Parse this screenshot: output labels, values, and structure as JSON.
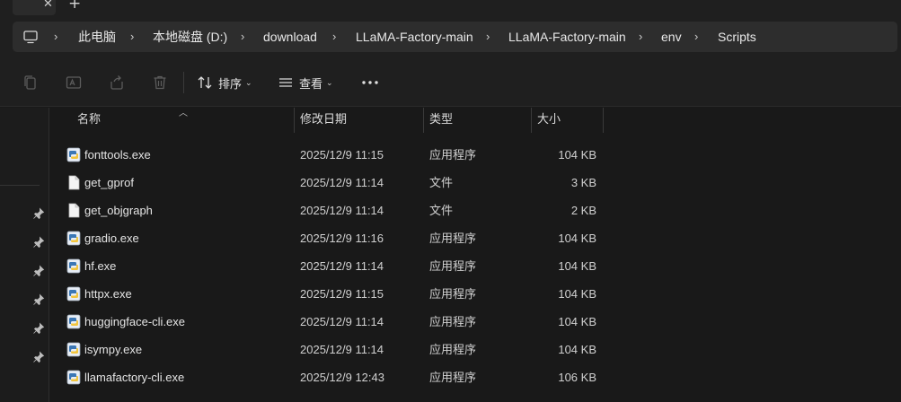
{
  "tabs": {
    "close_glyph": "✕",
    "new_tab_glyph": "+"
  },
  "address": {
    "breadcrumbs": [
      "此电脑",
      "本地磁盘 (D:)",
      "download",
      "LLaMA-Factory-main",
      "LLaMA-Factory-main",
      "env",
      "Scripts"
    ],
    "separator": "›"
  },
  "toolbar": {
    "sort_label": "排序",
    "view_label": "查看",
    "chevron": "⌄",
    "icons": [
      "copy-icon",
      "rename-icon",
      "share-icon",
      "delete-icon",
      "sort-icon",
      "view-icon",
      "more-icon"
    ]
  },
  "columns": {
    "name": "名称",
    "date": "修改日期",
    "type": "类型",
    "size": "大小"
  },
  "files": [
    {
      "name": "fonttools.exe",
      "date": "2025/12/9 11:15",
      "type": "应用程序",
      "size": "104 KB",
      "icon": "python-exe-icon"
    },
    {
      "name": "get_gprof",
      "date": "2025/12/9 11:14",
      "type": "文件",
      "size": "3 KB",
      "icon": "file-icon"
    },
    {
      "name": "get_objgraph",
      "date": "2025/12/9 11:14",
      "type": "文件",
      "size": "2 KB",
      "icon": "file-icon"
    },
    {
      "name": "gradio.exe",
      "date": "2025/12/9 11:16",
      "type": "应用程序",
      "size": "104 KB",
      "icon": "python-exe-icon"
    },
    {
      "name": "hf.exe",
      "date": "2025/12/9 11:14",
      "type": "应用程序",
      "size": "104 KB",
      "icon": "python-exe-icon"
    },
    {
      "name": "httpx.exe",
      "date": "2025/12/9 11:15",
      "type": "应用程序",
      "size": "104 KB",
      "icon": "python-exe-icon"
    },
    {
      "name": "huggingface-cli.exe",
      "date": "2025/12/9 11:14",
      "type": "应用程序",
      "size": "104 KB",
      "icon": "python-exe-icon"
    },
    {
      "name": "isympy.exe",
      "date": "2025/12/9 11:14",
      "type": "应用程序",
      "size": "104 KB",
      "icon": "python-exe-icon"
    },
    {
      "name": "llamafactory-cli.exe",
      "date": "2025/12/9 12:43",
      "type": "应用程序",
      "size": "106 KB",
      "icon": "python-exe-icon"
    }
  ],
  "colors": {
    "background": "#191919",
    "toolbar": "#1f1f1f",
    "address_bar": "#2d2d2d",
    "text": "#e4e4e4"
  }
}
